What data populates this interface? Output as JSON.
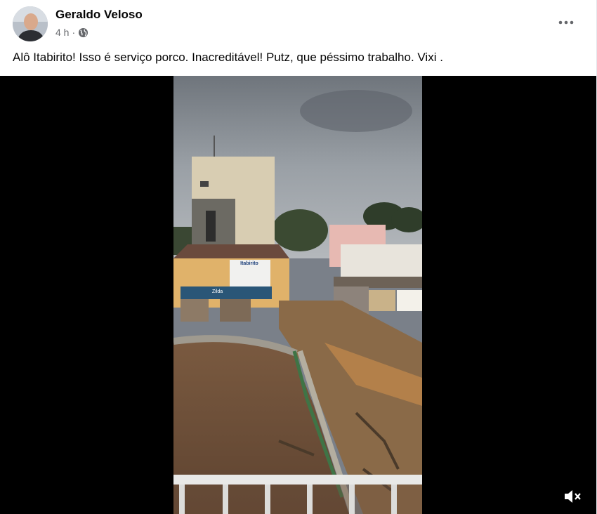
{
  "post": {
    "author_name": "Geraldo Veloso",
    "timestamp": "4 h",
    "separator": "·",
    "privacy_icon": "globe-icon",
    "text": "Alô Itabirito! Isso é serviço porco. Inacreditável! Putz, que péssimo trabalho. Vixi .",
    "more_icon": "more-options-icon"
  },
  "video": {
    "scene_signs": {
      "shop_sign_top": "Itabirito",
      "shop_sign_name": "Zilda"
    },
    "controls": {
      "mute_icon": "volume-muted-icon"
    }
  },
  "colors": {
    "text_primary": "#050505",
    "text_secondary": "#65676b",
    "video_background": "#000000"
  }
}
